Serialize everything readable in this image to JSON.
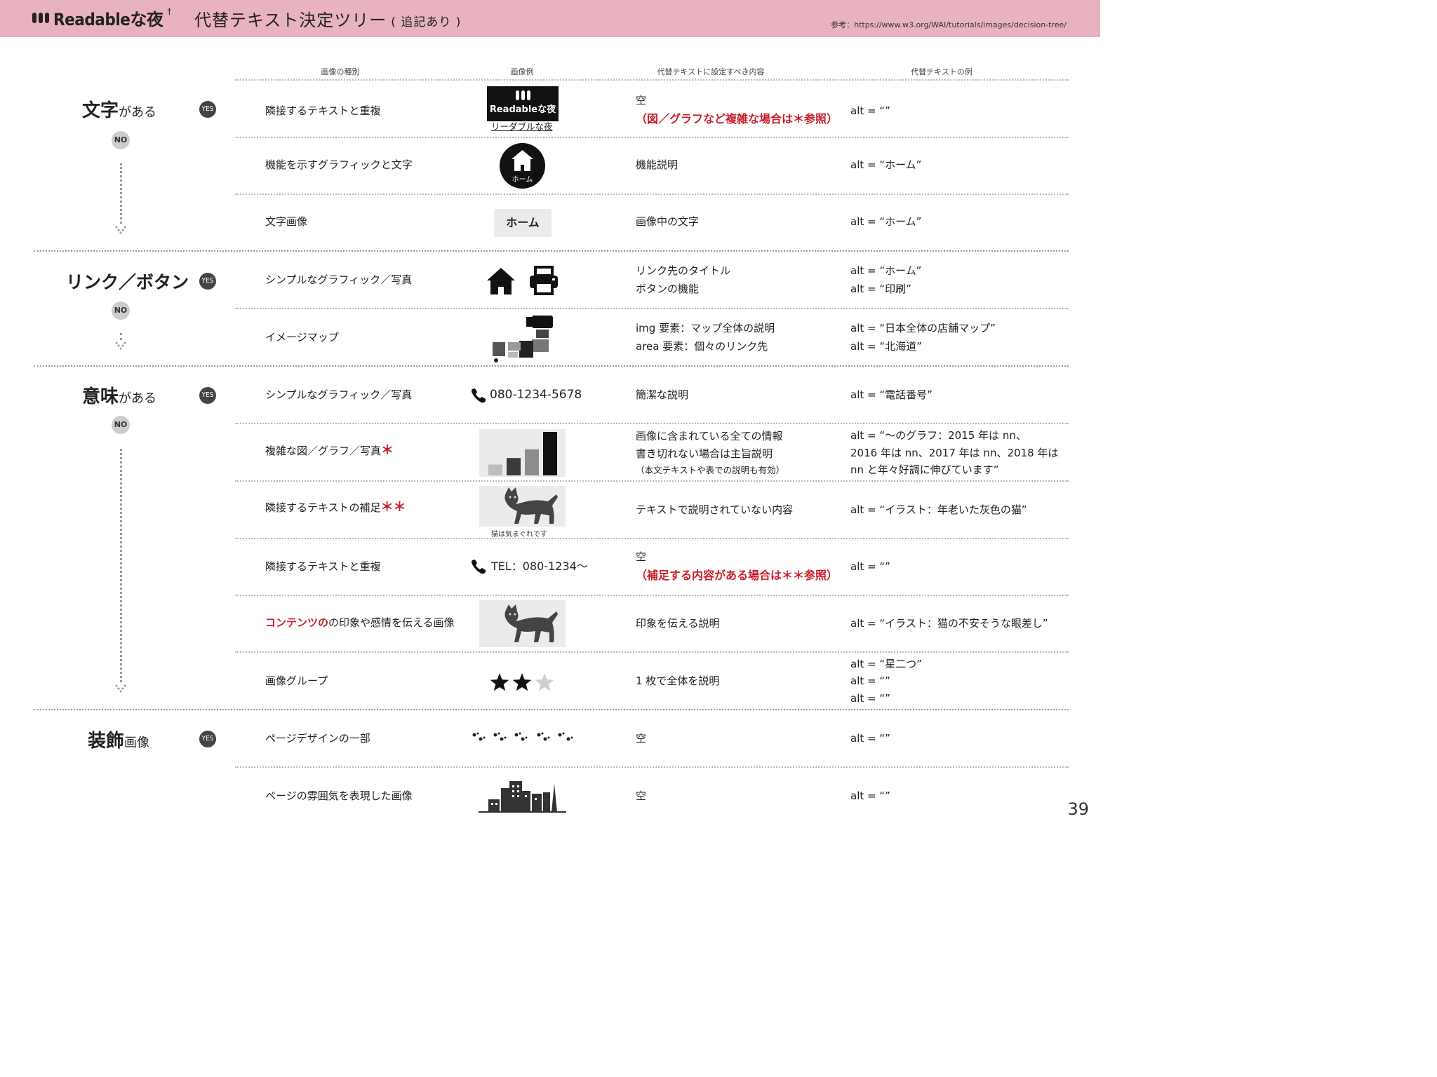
{
  "header": {
    "logo": "Readableな夜",
    "logo_sup": "†",
    "title": "代替テキスト決定ツリー",
    "title_note": "( 追記あり )",
    "reference": "参考：https://www.w3.org/WAI/tutorials/images/decision-tree/"
  },
  "columns": [
    "画像の種別",
    "画像例",
    "代替テキストに設定すべき内容",
    "代替テキストの例"
  ],
  "categories": [
    {
      "main": "文字",
      "suffix": "がある"
    },
    {
      "main": "リンク／ボタン",
      "suffix": ""
    },
    {
      "main": "意味",
      "suffix": "がある"
    },
    {
      "main": "装飾",
      "suffix": "画像"
    }
  ],
  "yes": "YES",
  "no": "NO",
  "rows": [
    {
      "type": "隣接するテキストと重複",
      "content": [
        "空"
      ],
      "content_red": "（図／グラフなど複雑な場合は＊参照）",
      "alt": [
        "alt = “”"
      ]
    },
    {
      "type": "機能を示すグラフィックと文字",
      "content": [
        "機能説明"
      ],
      "alt": [
        "alt = “ホーム”"
      ]
    },
    {
      "type": "文字画像",
      "content": [
        "画像中の文字"
      ],
      "alt": [
        "alt = “ホーム”"
      ]
    },
    {
      "type": "シンプルなグラフィック／写真",
      "content": [
        "リンク先のタイトル",
        "ボタンの機能"
      ],
      "alt": [
        "alt = “ホーム”",
        "alt = “印刷”"
      ]
    },
    {
      "type": "イメージマップ",
      "content": [
        "img 要素：マップ全体の説明",
        "area 要素：個々のリンク先"
      ],
      "alt": [
        "alt = “日本全体の店舗マップ”",
        "alt = “北海道”"
      ]
    },
    {
      "type": "シンプルなグラフィック／写真",
      "content": [
        "簡潔な説明"
      ],
      "alt": [
        "alt = “電話番号”"
      ]
    },
    {
      "type": "複雑な図／グラフ／写真",
      "mark": "＊",
      "content": [
        "画像に含まれている全ての情報",
        "書き切れない場合は主旨説明"
      ],
      "content_small": "（本文テキストや表での説明も有効）",
      "alt": [
        "alt = “〜のグラフ：2015 年は nn、",
        "2016 年は nn、2017 年は nn、2018 年は",
        "nn と年々好調に伸びています”"
      ]
    },
    {
      "type": "隣接するテキストの補足",
      "mark": "＊＊",
      "content": [
        "テキストで説明されていない内容"
      ],
      "alt": [
        "alt = “イラスト：年老いた灰色の猫”"
      ]
    },
    {
      "type": "隣接するテキストと重複",
      "content": [
        "空"
      ],
      "content_red": "（補足する内容がある場合は＊＊参照）",
      "alt": [
        "alt = “”"
      ]
    },
    {
      "type": "の印象や感情を伝える画像",
      "type_red": "コンテンツの",
      "content": [
        "印象を伝える説明"
      ],
      "alt": [
        "alt = “イラスト：猫の不安そうな眼差し”"
      ]
    },
    {
      "type": "画像グループ",
      "content": [
        "1 枚で全体を説明"
      ],
      "alt": [
        "alt = “星二つ”",
        "alt = “”",
        "alt = “”"
      ]
    },
    {
      "type": "ページデザインの一部",
      "content": [
        "空"
      ],
      "alt": [
        "alt = “”"
      ]
    },
    {
      "type": "ページの雰囲気を表現した画像",
      "content": [
        "空"
      ],
      "alt": [
        "alt = “”"
      ]
    }
  ],
  "examples": {
    "logo_text": "Readableな夜",
    "logo_caption": "リーダブルな夜",
    "home_label": "ホーム",
    "home_text_image": "ホーム",
    "phone": "080-1234-5678",
    "tel": "TEL：080-1234〜",
    "cat_caption": "猫は気まぐれです",
    "bar_chart_values": [
      1,
      1.6,
      2.4,
      4
    ],
    "stars_filled": 2,
    "stars_total": 3
  },
  "page_number": "39"
}
